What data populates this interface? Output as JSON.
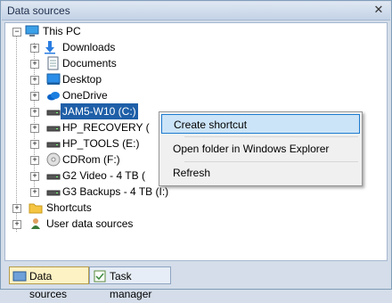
{
  "window": {
    "title": "Data sources",
    "close_glyph": "✕"
  },
  "tree": {
    "root": {
      "label": "This PC",
      "expander": "−"
    },
    "children": [
      {
        "label": "Downloads",
        "icon": "download-icon"
      },
      {
        "label": "Documents",
        "icon": "documents-icon"
      },
      {
        "label": "Desktop",
        "icon": "desktop-icon"
      },
      {
        "label": "OneDrive",
        "icon": "onedrive-icon"
      },
      {
        "label": "JAM5-W10 (C:)",
        "icon": "drive-icon",
        "selected": true
      },
      {
        "label": "HP_RECOVERY (",
        "icon": "drive-icon"
      },
      {
        "label": "HP_TOOLS (E:)",
        "icon": "drive-icon"
      },
      {
        "label": "CDRom (F:)",
        "icon": "cdrom-icon"
      },
      {
        "label": "G2 Video - 4 TB (",
        "icon": "drive-icon"
      },
      {
        "label": "G3 Backups - 4 TB (I:)",
        "icon": "drive-icon"
      }
    ],
    "top_level": [
      {
        "label": "Shortcuts",
        "icon": "folder-icon"
      },
      {
        "label": "User data sources",
        "icon": "user-sources-icon"
      }
    ],
    "expander_plus": "+"
  },
  "context_menu": {
    "items": [
      {
        "label": "Create shortcut",
        "highlighted": true
      },
      {
        "label": "Open folder in Windows Explorer"
      },
      {
        "label": "Refresh"
      }
    ]
  },
  "bottom_tabs": [
    {
      "label": "Data sources",
      "active": true
    },
    {
      "label": "Task manager",
      "active": false
    }
  ],
  "colors": {
    "selection": "#1f5fa8",
    "menu_hover": "#cce4f7",
    "active_tab": "#fdf2c4"
  }
}
